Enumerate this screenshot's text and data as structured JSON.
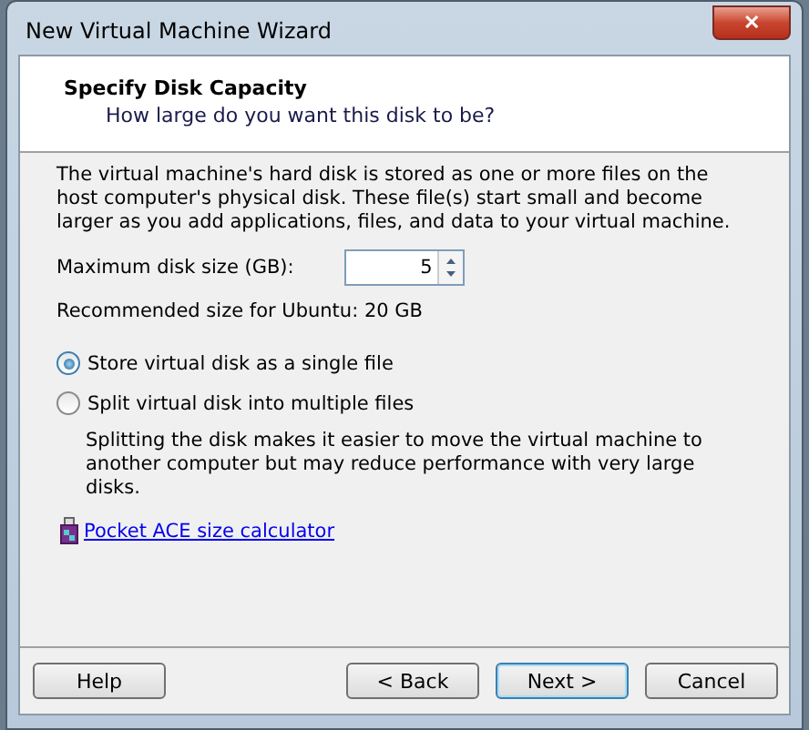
{
  "window": {
    "title": "New Virtual Machine Wizard",
    "close": "✕"
  },
  "header": {
    "title": "Specify Disk Capacity",
    "subtitle": "How large do you want this disk to be?"
  },
  "description": "The virtual machine's hard disk is stored as one or more files on the host computer's physical disk. These file(s) start small and become larger as you add applications, files, and data to your virtual machine.",
  "disk_size": {
    "label": "Maximum disk size (GB):",
    "value": "5"
  },
  "recommendation": "Recommended size for Ubuntu: 20 GB",
  "options": [
    {
      "label": "Store virtual disk as a single file",
      "selected": true
    },
    {
      "label": "Split virtual disk into multiple files",
      "selected": false
    }
  ],
  "split_note": "Splitting the disk makes it easier to move the virtual machine to another computer but may reduce performance with very large disks.",
  "link": "Pocket ACE size calculator",
  "buttons": [
    {
      "label": "Help",
      "default": false
    },
    {
      "label": "< Back",
      "default": false
    },
    {
      "label": "Next >",
      "default": true
    },
    {
      "label": "Cancel",
      "default": false
    }
  ]
}
